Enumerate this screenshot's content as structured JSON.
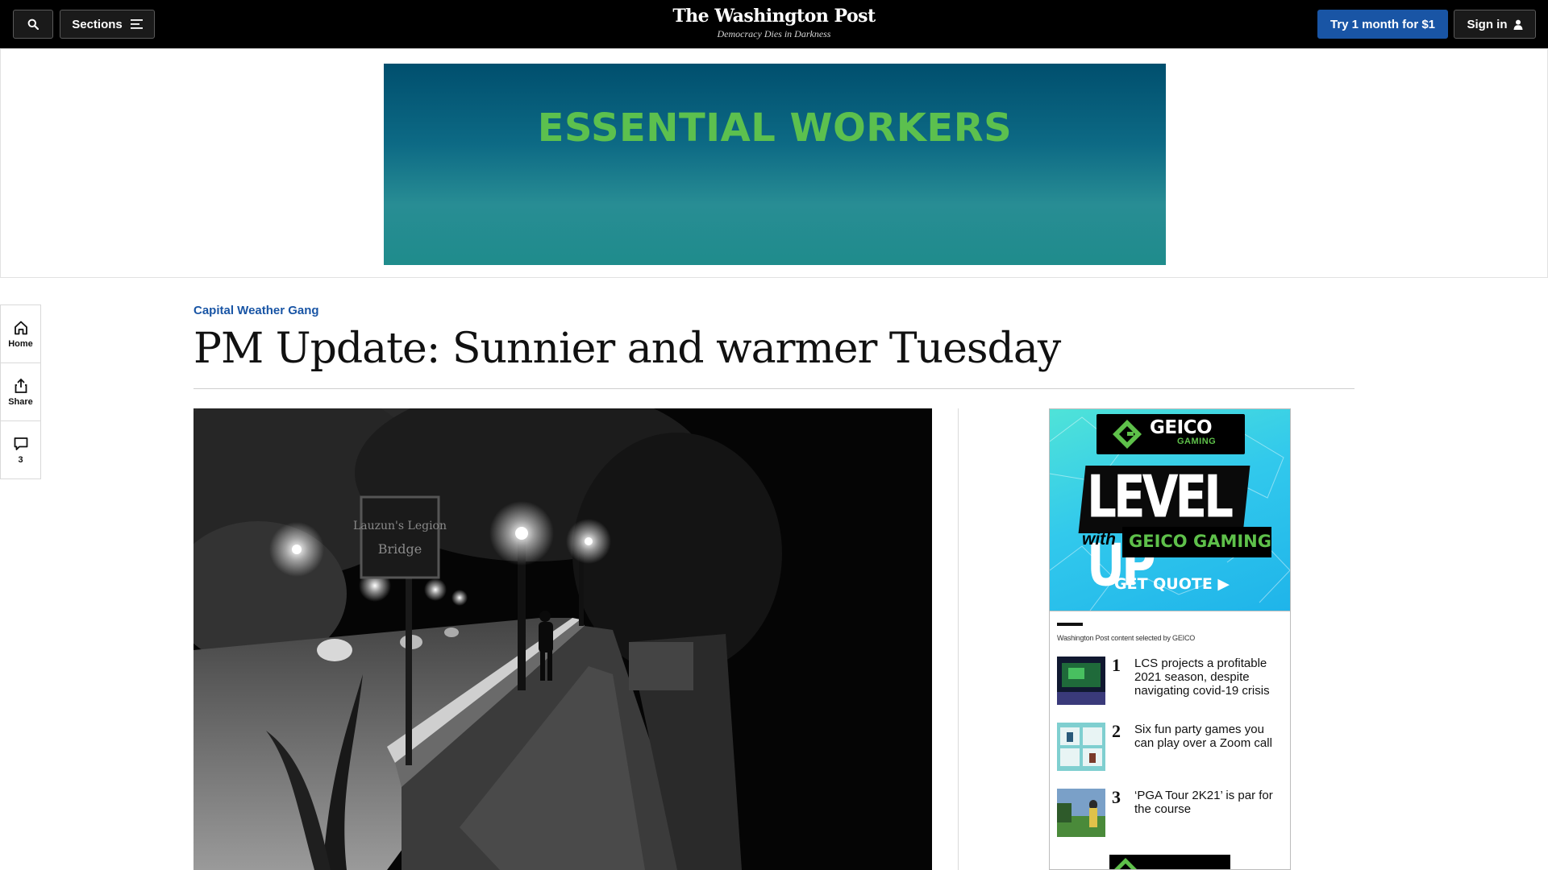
{
  "header": {
    "sections_label": "Sections",
    "brand_name": "The Washington Post",
    "brand_tagline": "Democracy Dies in Darkness",
    "subscribe_label": "Try 1 month for $1",
    "signin_label": "Sign in"
  },
  "top_ad": {
    "headline": "ESSENTIAL WORKERS"
  },
  "left_rail": {
    "home_label": "Home",
    "share_label": "Share",
    "comments_count": "3"
  },
  "article": {
    "kicker": "Capital Weather Gang",
    "headline": "PM Update: Sunnier and warmer Tuesday",
    "photo_sign_text": "Lauzun's Legion Bridge"
  },
  "side_ad": {
    "brand": "GEICO",
    "brand_sub": "GAMING",
    "level_up": "LEVEL UP",
    "with": "with",
    "geico_gaming": "GEICO GAMING",
    "get_quote": "GET QUOTE ▶",
    "list_label": "Washington Post content selected by GEICO",
    "items": [
      {
        "num": "1",
        "title": "LCS projects a profitable 2021 season, despite navigating covid-19 crisis"
      },
      {
        "num": "2",
        "title": "Six fun party games you can play over a Zoom call"
      },
      {
        "num": "3",
        "title": "‘PGA Tour 2K21’ is par for the course"
      }
    ]
  },
  "colors": {
    "accent_blue": "#1955a5",
    "nav_black": "#000000",
    "banner_text_green": "#5cc04e",
    "geico_green": "#5ec04a"
  },
  "icons": [
    "search-icon",
    "menu-icon",
    "user-icon",
    "home-icon",
    "share-icon",
    "comment-icon",
    "play-icon"
  ]
}
